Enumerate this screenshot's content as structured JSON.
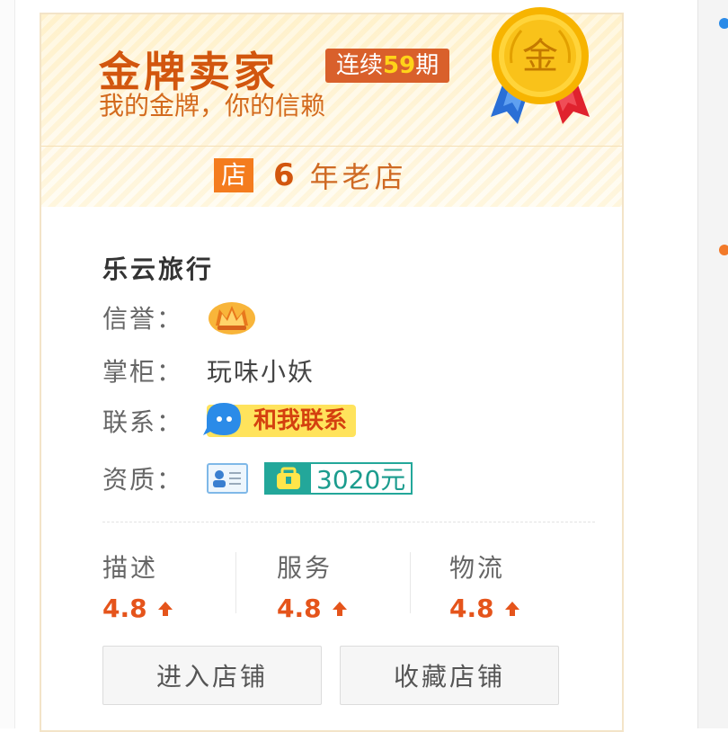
{
  "banner": {
    "title": "金牌卖家",
    "streak_prefix": "连续",
    "streak_number": "59",
    "streak_suffix": "期",
    "slogan": "我的金牌，你的信赖",
    "medal_char": "金",
    "shop_badge": "店",
    "years_num": "6",
    "years_text": "年老店"
  },
  "shop": {
    "name": "乐云旅行",
    "credit_label": "信誉：",
    "credit_icon": "crown-icon",
    "owner_label": "掌柜：",
    "owner_name": "玩味小妖",
    "contact_label": "联系：",
    "contact_button": "和我联系",
    "qualification_label": "资质：",
    "deposit_amount": "3020元"
  },
  "scores": [
    {
      "label": "描述",
      "value": "4.8",
      "trend": "up"
    },
    {
      "label": "服务",
      "value": "4.8",
      "trend": "up"
    },
    {
      "label": "物流",
      "value": "4.8",
      "trend": "up"
    }
  ],
  "buttons": {
    "enter_shop": "进入店铺",
    "favorite_shop": "收藏店铺"
  },
  "colors": {
    "accent": "#d2560e",
    "score": "#e5541b",
    "deposit": "#23a79a",
    "contact": "#ffe35c"
  }
}
